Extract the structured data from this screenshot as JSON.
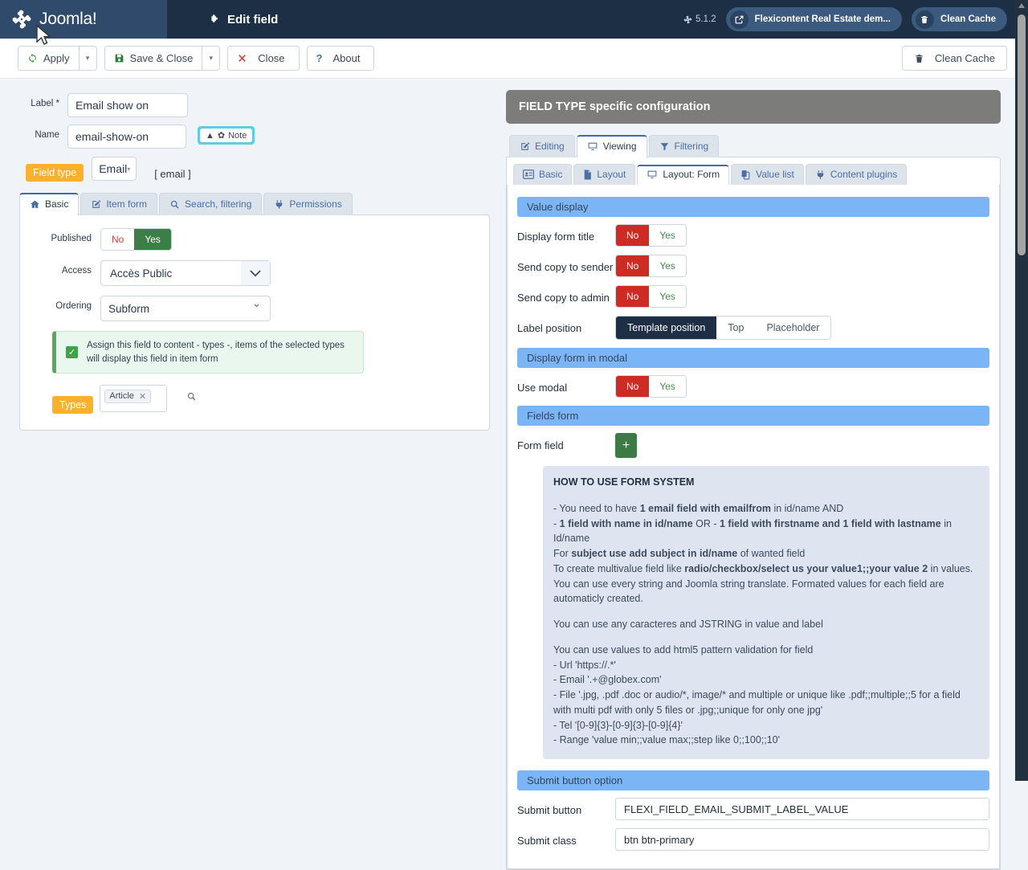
{
  "navbar": {
    "brand": "Joomla!",
    "title": "Edit field",
    "version": "5.1.2",
    "site_pill": "Flexicontent Real Estate dem...",
    "cache_pill": "Clean Cache"
  },
  "toolbar": {
    "apply": "Apply",
    "save_close": "Save & Close",
    "close": "Close",
    "about": "About",
    "clean_cache": "Clean Cache"
  },
  "left": {
    "label_label": "Label *",
    "label_value": "Email show on",
    "name_label": "Name",
    "name_value": "email-show-on",
    "note_button": "Note",
    "fieldtype_tag": "Field type",
    "fieldtype_value": "Email",
    "fieldtype_hint": "[ email ]",
    "tabs": [
      {
        "label": "Basic",
        "icon": "home-icon",
        "active": true
      },
      {
        "label": "Item form",
        "icon": "pencil-square-icon",
        "active": false
      },
      {
        "label": "Search, filtering",
        "icon": "search-icon",
        "active": false
      },
      {
        "label": "Permissions",
        "icon": "plug-icon",
        "active": false
      }
    ],
    "published_label": "Published",
    "published_no": "No",
    "published_yes": "Yes",
    "published_value": "Yes",
    "access_label": "Access",
    "access_value": "Accès Public",
    "ordering_label": "Ordering",
    "ordering_value": "Subform",
    "ordering_options": [
      "Subform"
    ],
    "assign_alert": "Assign this field to content - types -, items of the selected types will display this field in item form",
    "types_tag": "Types",
    "types_chip": "Article"
  },
  "right": {
    "panel_title": "FIELD TYPE specific configuration",
    "tabs_l1": [
      {
        "label": "Editing",
        "icon": "pencil-square-icon",
        "active": false
      },
      {
        "label": "Viewing",
        "icon": "monitor-icon",
        "active": true
      },
      {
        "label": "Filtering",
        "icon": "funnel-icon",
        "active": false
      }
    ],
    "tabs_l2": [
      {
        "label": "Basic",
        "icon": "id-card-icon",
        "active": false
      },
      {
        "label": "Layout",
        "icon": "file-icon",
        "active": false
      },
      {
        "label": "Layout: Form",
        "icon": "monitor-icon",
        "active": true
      },
      {
        "label": "Value list",
        "icon": "copy-icon",
        "active": false
      },
      {
        "label": "Content plugins",
        "icon": "plug-icon",
        "active": false
      }
    ],
    "sections": {
      "value_display": "Value display",
      "display_in_modal": "Display form in modal",
      "fields_form": "Fields form",
      "submit_option": "Submit button option"
    },
    "rows": {
      "display_form_title": {
        "label": "Display form title",
        "no": "No",
        "yes": "Yes",
        "value": "No"
      },
      "send_copy_sender": {
        "label": "Send copy to sender",
        "no": "No",
        "yes": "Yes",
        "value": "No"
      },
      "send_copy_admin": {
        "label": "Send copy to admin",
        "no": "No",
        "yes": "Yes",
        "value": "No"
      },
      "label_position": {
        "label": "Label position",
        "options": [
          "Template position",
          "Top",
          "Placeholder"
        ],
        "value": "Template position"
      },
      "use_modal": {
        "label": "Use modal",
        "no": "No",
        "yes": "Yes",
        "value": "No"
      },
      "form_field": {
        "label": "Form field",
        "add": "+"
      },
      "submit_button": {
        "label": "Submit button",
        "value": "FLEXI_FIELD_EMAIL_SUBMIT_LABEL_VALUE"
      },
      "submit_class": {
        "label": "Submit class",
        "value": "btn btn-primary"
      }
    },
    "help": {
      "title": "HOW TO USE FORM SYSTEM",
      "l1a": "- You need to have ",
      "l1b": "1 email field with emailfrom",
      "l1c": " in id/name AND",
      "l2a": "- ",
      "l2b": "1 field with name in id/name",
      "l2c": " OR - ",
      "l2d": "1 field with firstname and 1 field with lastname",
      "l2e": " in Id/name",
      "l3a": "For ",
      "l3b": "subject use add subject in id/name",
      "l3c": " of wanted field",
      "l4a": "To create multivalue field like ",
      "l4b": "radio/checkbox/select us your value1;;your value 2",
      "l4c": " in values. You can use every string and Joomla string translate. Formated values for each field are automaticly created.",
      "p2": "You can use any caracteres and JSTRING in value and label",
      "p3": "You can use values to add html5 pattern validation for field",
      "p3_l1": "- Url 'https://.*'",
      "p3_l2": "- Email '.+@globex.com'",
      "p3_l3": "- File '.jpg, .pdf .doc or audio/*, image/* and multiple or unique like .pdf;;multiple;;5 for a field with multi pdf with only 5 files or .jpg;;unique for only one jpg'",
      "p3_l4": "- Tel '[0-9]{3}-[0-9]{3}-[0-9]{4}'",
      "p3_l5": "- Range 'value min;;value max;;step like 0;;100;;10'"
    }
  },
  "colors": {
    "navbar": "#1c2f45",
    "brand_block": "#2f4a6b",
    "panel_head": "#7c7c7a",
    "section_hdr": "#7cb5f5",
    "danger": "#ce2b25",
    "success": "#3c7f46",
    "orange_tag": "#fcb02b",
    "note_cyan": "#61cbe4",
    "dark_seg": "#1e2f45"
  }
}
